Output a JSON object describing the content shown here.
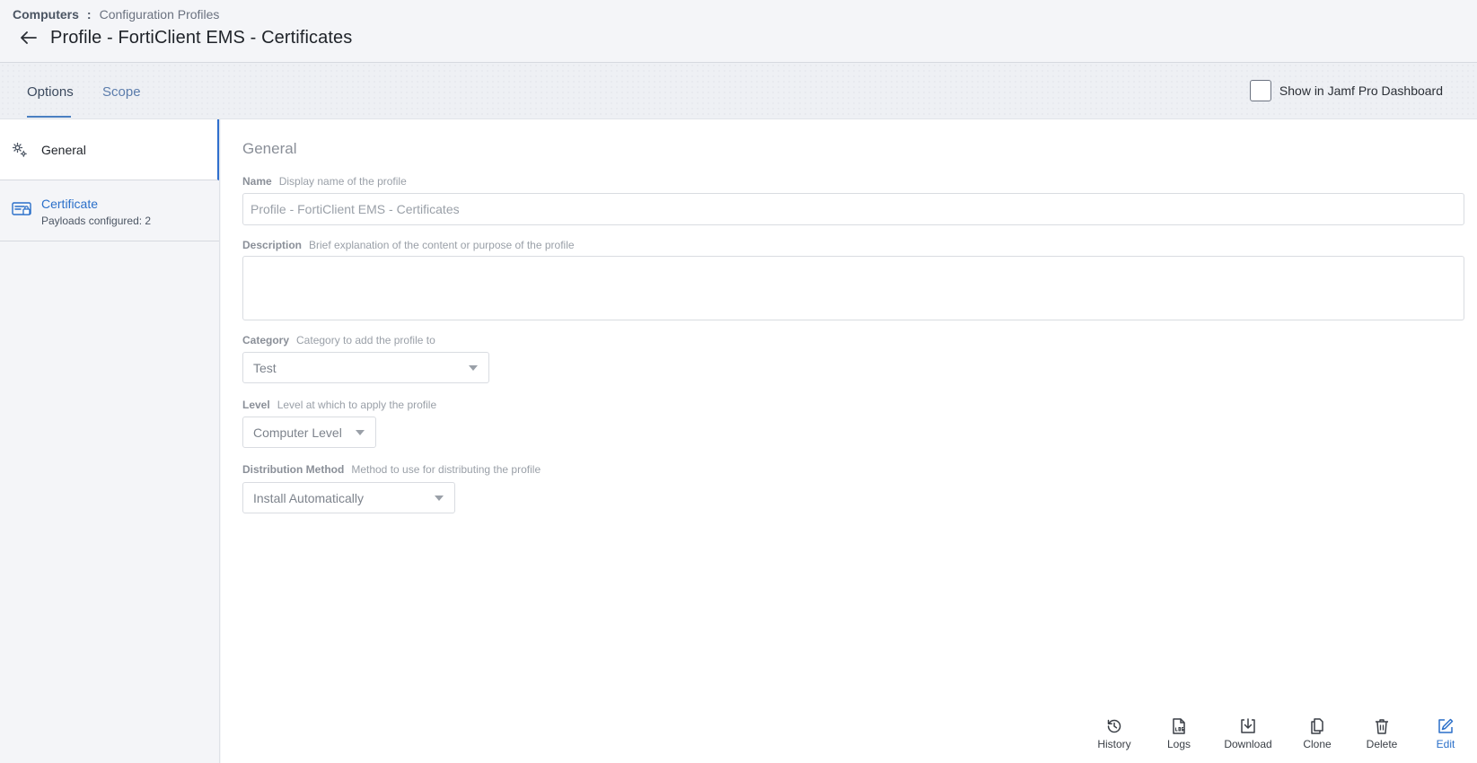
{
  "breadcrumb": {
    "root": "Computers",
    "separator": ":",
    "current": "Configuration Profiles"
  },
  "page": {
    "title": "Profile - FortiClient EMS - Certificates"
  },
  "tabs": [
    {
      "label": "Options"
    },
    {
      "label": "Scope"
    }
  ],
  "dashboard": {
    "label": "Show in Jamf Pro Dashboard",
    "checked": false
  },
  "sidebar": {
    "items": [
      {
        "label": "General",
        "icon": "gear-icon"
      },
      {
        "label": "Certificate",
        "sub": "Payloads configured: 2",
        "icon": "certificate-icon"
      }
    ]
  },
  "general": {
    "title": "General",
    "name": {
      "label": "Name",
      "hint": "Display name of the profile",
      "value": "Profile - FortiClient EMS - Certificates"
    },
    "description": {
      "label": "Description",
      "hint": "Brief explanation of the content or purpose of the profile",
      "value": ""
    },
    "category": {
      "label": "Category",
      "hint": "Category to add the profile to",
      "value": "Test"
    },
    "level": {
      "label": "Level",
      "hint": "Level at which to apply the profile",
      "value": "Computer Level"
    },
    "distribution": {
      "label": "Distribution Method",
      "hint": "Method to use for distributing the profile",
      "value": "Install Automatically"
    }
  },
  "actions": {
    "history": "History",
    "logs": "Logs",
    "download": "Download",
    "clone": "Clone",
    "delete": "Delete",
    "edit": "Edit"
  },
  "colors": {
    "accent": "#2a6fc9",
    "text": "#1f2329",
    "muted": "#9aa0a8"
  }
}
